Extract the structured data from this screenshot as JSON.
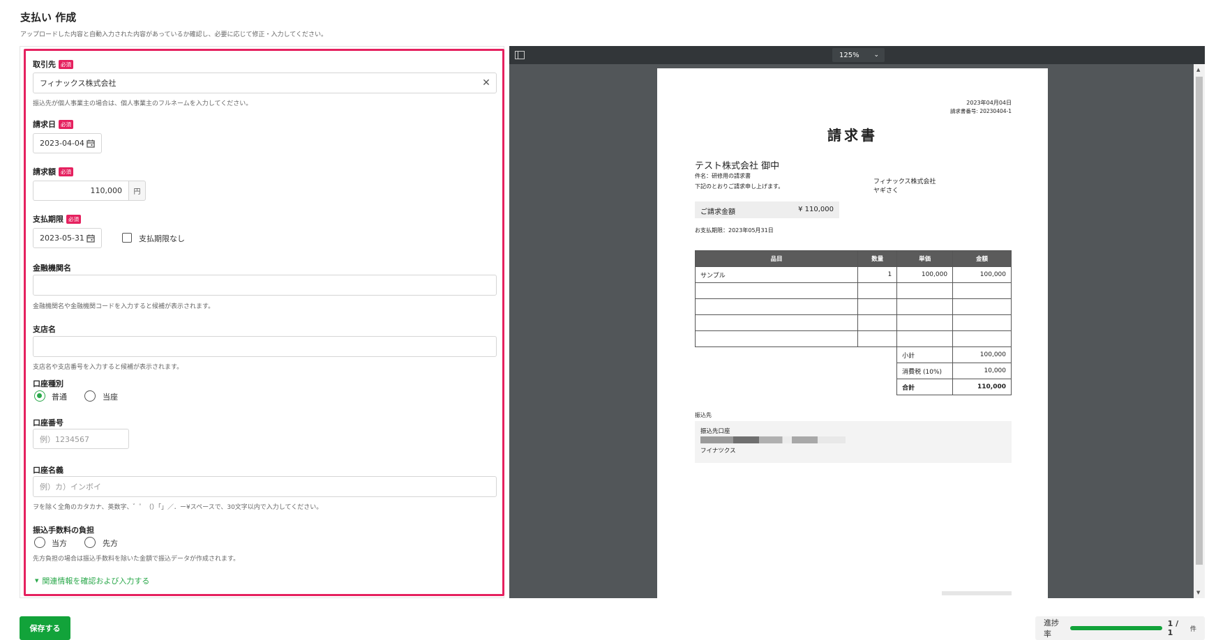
{
  "page": {
    "title": "支払い 作成",
    "description": "アップロードした内容と自動入力された内容があっているか確認し、必要に応じて修正・入力してください。"
  },
  "form": {
    "required_badge": "必須",
    "vendor": {
      "label": "取引先",
      "value": "フィナックス株式会社",
      "help": "振込先が個人事業主の場合は、個人事業主のフルネームを入力してください。"
    },
    "invoice_date": {
      "label": "請求日",
      "value": "2023-04-04"
    },
    "amount": {
      "label": "請求額",
      "value": "110,000",
      "unit": "円"
    },
    "due_date": {
      "label": "支払期限",
      "value": "2023-05-31",
      "no_due_label": "支払期限なし",
      "no_due_checked": false
    },
    "bank": {
      "label": "金融機関名",
      "value": "",
      "help": "金融機関名や金融機関コードを入力すると候補が表示されます。"
    },
    "branch": {
      "label": "支店名",
      "value": "",
      "help": "支店名や支店番号を入力すると候補が表示されます。"
    },
    "account_type": {
      "label": "口座種別",
      "options": [
        "普通",
        "当座"
      ],
      "selected": "普通"
    },
    "account_number": {
      "label": "口座番号",
      "placeholder": "例）1234567"
    },
    "account_holder": {
      "label": "口座名義",
      "placeholder": "例）カ）インボイ",
      "help": "ヲを除く全角のカタカナ、英数字、゛゜（）「」／．ー¥スペースで、30文字以内で入力してください。"
    },
    "fee": {
      "label": "振込手数料の負担",
      "options": [
        "当方",
        "先方"
      ],
      "selected": "",
      "help": "先方負担の場合は振込手数料を除いた金額で振込データが作成されます。"
    },
    "related_link": "関連情報を確認および入力する"
  },
  "viewer": {
    "zoom": "125%",
    "invoice": {
      "date": "2023年04月04日",
      "number": "請求書番号: 20230404-1",
      "title": "請求書",
      "recipient": "テスト株式会社 御中",
      "subject": "件名：研修用の請求書",
      "intro": "下記のとおりご請求申し上げます。",
      "issuer": "フィナックス株式会社",
      "issuer_person": "ヤギさく",
      "total_label": "ご請求金額",
      "total_value": "¥ 110,000",
      "due": "お支払期限：2023年05月31日",
      "table_headers": [
        "品目",
        "数量",
        "単価",
        "金額"
      ],
      "rows": [
        [
          "サンプル",
          "1",
          "100,000",
          "100,000"
        ],
        [
          "",
          "",
          "",
          ""
        ],
        [
          "",
          "",
          "",
          ""
        ],
        [
          "",
          "",
          "",
          ""
        ],
        [
          "",
          "",
          "",
          ""
        ]
      ],
      "subtotal_label": "小計",
      "subtotal_value": "100,000",
      "tax_label": "消費税 (10%)",
      "tax_value": "10,000",
      "sum_label": "合計",
      "sum_value": "110,000",
      "transfer_heading": "振込先",
      "account_label": "振込先口座",
      "account_name": "フイナツクス"
    }
  },
  "footer": {
    "save_label": "保存する",
    "progress_label": "進捗率",
    "progress_fraction": 1.0,
    "progress_count": "1 / 1",
    "progress_unit": "件"
  },
  "colors": {
    "accent_green": "#12a33a",
    "highlight_pink": "#e5215f",
    "viewer_bg": "#525659"
  }
}
